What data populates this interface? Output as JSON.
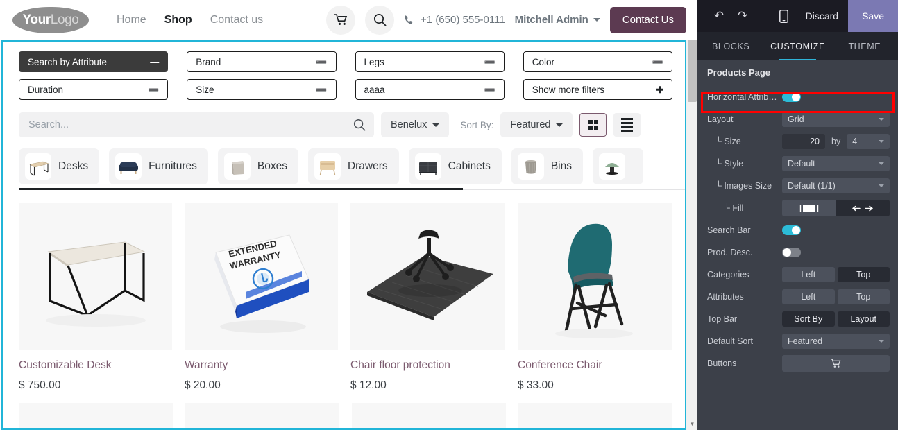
{
  "site": {
    "logo_bold": "Your",
    "logo_light": "Logo",
    "nav": [
      {
        "label": "Home",
        "active": false
      },
      {
        "label": "Shop",
        "active": true
      },
      {
        "label": "Contact us",
        "active": false
      }
    ],
    "cart_icon": "shopping-cart-icon",
    "search_icon": "search-icon",
    "phone_icon": "phone-icon",
    "phone": "+1 (650) 555-0111",
    "user": "Mitchell Admin",
    "contact_button": "Contact Us"
  },
  "filters": {
    "attributes": [
      {
        "label": "Search by Attribute",
        "glyph": "minus",
        "style": "dark"
      },
      {
        "label": "Brand",
        "glyph": "chevron-down",
        "style": "light"
      },
      {
        "label": "Legs",
        "glyph": "chevron-down",
        "style": "light"
      },
      {
        "label": "Color",
        "glyph": "chevron-down",
        "style": "light"
      },
      {
        "label": "Duration",
        "glyph": "chevron-down",
        "style": "light"
      },
      {
        "label": "Size",
        "glyph": "chevron-down",
        "style": "light"
      },
      {
        "label": "aaaa",
        "glyph": "chevron-down",
        "style": "light"
      },
      {
        "label": "Show more filters",
        "glyph": "plus",
        "style": "light"
      }
    ]
  },
  "toolbar": {
    "search_placeholder": "Search...",
    "search_value": "",
    "search_submit_icon": "search-icon",
    "pricelist": "Benelux",
    "sort_label": "Sort By:",
    "sort_value": "Featured",
    "grid_view_icon": "grid-view-icon",
    "list_view_icon": "list-view-icon",
    "active_view": "grid"
  },
  "categories": [
    {
      "label": "Desks",
      "icon": "desk-thumb"
    },
    {
      "label": "Furnitures",
      "icon": "sofa-thumb"
    },
    {
      "label": "Boxes",
      "icon": "box-thumb"
    },
    {
      "label": "Drawers",
      "icon": "drawer-thumb"
    },
    {
      "label": "Cabinets",
      "icon": "cabinet-thumb"
    },
    {
      "label": "Bins",
      "icon": "bin-thumb"
    },
    {
      "label": "",
      "icon": "lamp-thumb"
    }
  ],
  "products": [
    {
      "name": "Customizable Desk",
      "price": "$ 750.00",
      "image": "desk-image"
    },
    {
      "name": "Warranty",
      "price": "$ 20.00",
      "image": "warranty-box-image"
    },
    {
      "name": "Chair floor protection",
      "price": "$ 12.00",
      "image": "floor-mat-image"
    },
    {
      "name": "Conference Chair",
      "price": "$ 33.00",
      "image": "conference-chair-image"
    }
  ],
  "warranty_box": {
    "line1": "EXTENDED",
    "line2": "WARRANTY"
  },
  "editor": {
    "undo_icon": "undo-icon",
    "redo_icon": "redo-icon",
    "mobile_icon": "mobile-preview-icon",
    "discard_label": "Discard",
    "save_label": "Save",
    "tabs": [
      {
        "label": "BLOCKS",
        "active": false
      },
      {
        "label": "CUSTOMIZE",
        "active": true
      },
      {
        "label": "THEME",
        "active": false
      }
    ],
    "section_title": "Products Page",
    "options": {
      "horizontal_attributes": {
        "label": "Horizontal Attrib…",
        "value": "on"
      },
      "layout": {
        "label": "Layout",
        "value": "Grid"
      },
      "size": {
        "label": "└ Size",
        "cols": "20",
        "by": "by",
        "rows": "4"
      },
      "style": {
        "label": "└ Style",
        "value": "Default"
      },
      "images_size": {
        "label": "└ Images Size",
        "value": "Default (1/1)"
      },
      "fill": {
        "label": "└ Fill",
        "left_icon": "fill-contain-icon",
        "right_icon": "fill-stretch-icon",
        "active": "right"
      },
      "search_bar": {
        "label": "Search Bar",
        "value": "on"
      },
      "prod_desc": {
        "label": "Prod. Desc.",
        "value": "off"
      },
      "categories": {
        "label": "Categories",
        "options": [
          "Left",
          "Top"
        ],
        "active": "Top"
      },
      "attributes": {
        "label": "Attributes",
        "options": [
          "Left",
          "Top"
        ],
        "active": "none"
      },
      "top_bar": {
        "label": "Top Bar",
        "options": [
          "Sort By",
          "Layout"
        ],
        "active": "both"
      },
      "default_sort": {
        "label": "Default Sort",
        "value": "Featured"
      },
      "buttons": {
        "label": "Buttons",
        "icon": "cart-icon"
      }
    }
  },
  "colors": {
    "accent_cyan": "#2cbcd8",
    "selection_outline": "#21b5d8",
    "highlight_red": "#ff0000",
    "save_purple": "#7b79b3",
    "contact_button": "#5c3a51",
    "product_title": "#7b5a6e"
  }
}
